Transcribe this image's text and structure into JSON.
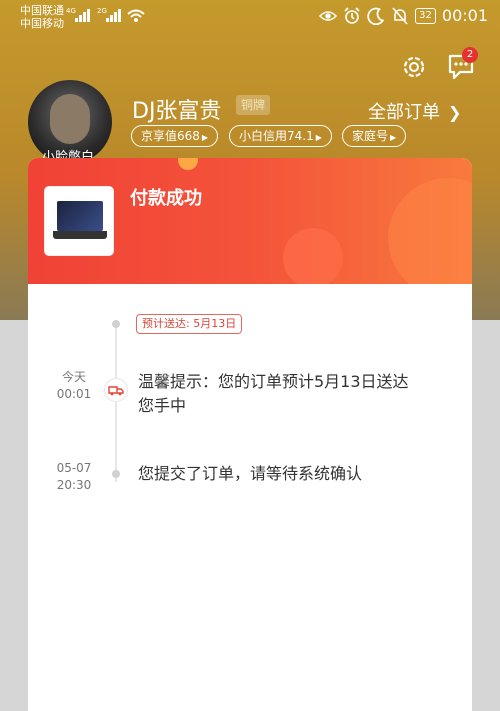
{
  "status_bar": {
    "carrier1": "中国联通",
    "carrier2": "中国移动",
    "net1": "4G",
    "net2": "2G",
    "battery": "32",
    "time": "00:01"
  },
  "header": {
    "notification_count": "2"
  },
  "profile": {
    "avatar_caption": "小脸憋白",
    "username": "DJ张富贵",
    "rank": "铜牌",
    "all_orders": "全部订单",
    "tags": [
      "京享值668",
      "小白信用74.1",
      "家庭号"
    ]
  },
  "card": {
    "title": "付款成功",
    "eta": "预计送达: 5月13日",
    "timeline": [
      {
        "date": "今天",
        "time": "00:01",
        "text_line1": "温馨提示：您的订单预计5月13日送达",
        "text_line2": "您手中"
      },
      {
        "date": "05-07",
        "time": "20:30",
        "text_line1": "您提交了订单，请等待系统确认"
      }
    ]
  },
  "colors": {
    "header_bg": "#c59a2c",
    "accent_red": "#f04236"
  }
}
